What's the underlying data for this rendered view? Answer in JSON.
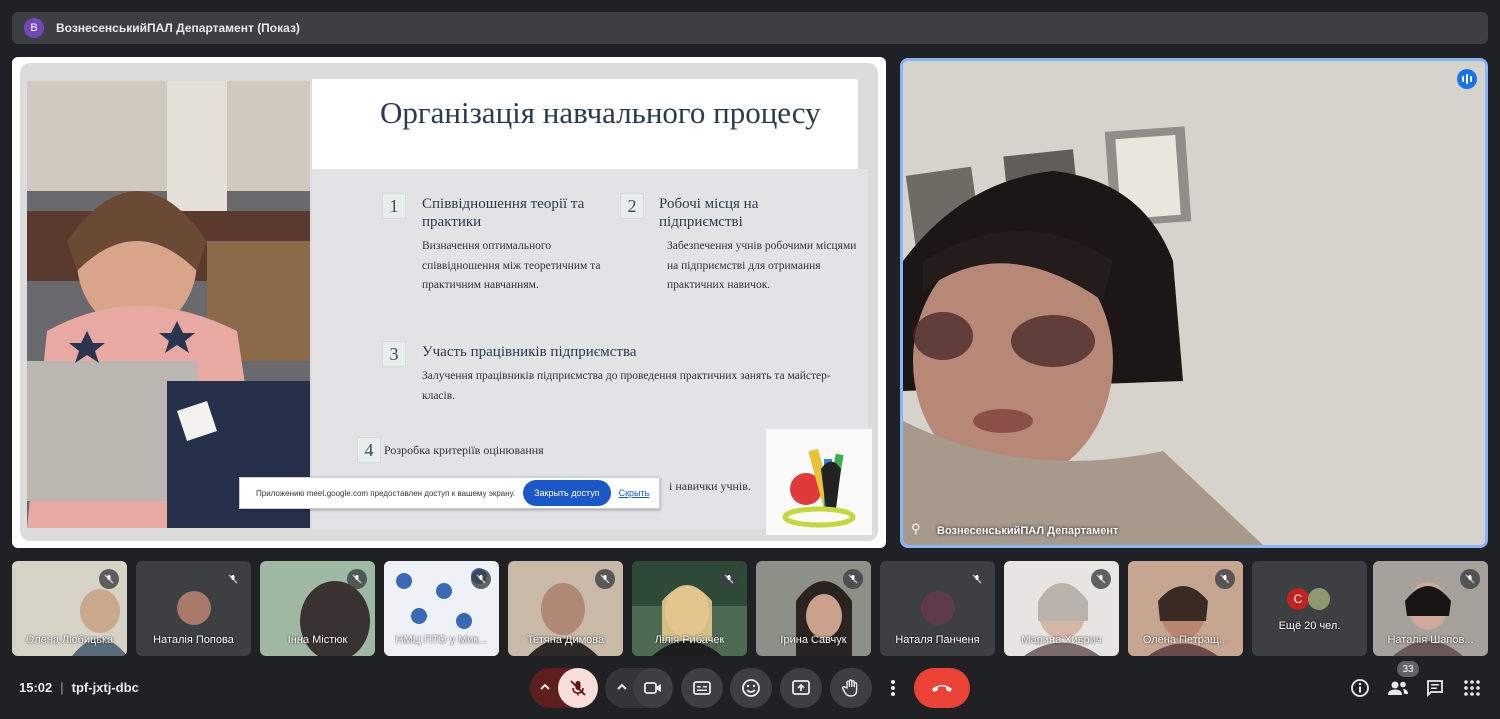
{
  "top_bar": {
    "avatar_letter": "B",
    "title": "ВознесенськийПАЛ Департамент (Показ)"
  },
  "slide": {
    "title": "Організація навчального процесу",
    "items": [
      {
        "num": "1",
        "heading": "Співвідношення теорії та практики",
        "text": "Визначення оптимального співвідношення між теоретичним та практичним навчанням."
      },
      {
        "num": "2",
        "heading": "Робочі місця на підприємстві",
        "text": "Забезпечення учнів робочими місцями на підприємстві для отримання практичних навичок."
      },
      {
        "num": "3",
        "heading": "Участь працівників підприємства",
        "text": "Залучення працівників підприємства до проведення практичних занять та майстер-класів."
      },
      {
        "num": "4",
        "heading": "Розробка критеріїв оцінювання",
        "text": "і навички учнів."
      }
    ],
    "share_banner": {
      "text": "Приложению meet.google.com предоставлен доступ к вашему экрану.",
      "stop_button": "Закрыть доступ",
      "hide_link": "Скрыть"
    }
  },
  "speaker": {
    "name": "ВознесенськийПАЛ Департамент"
  },
  "participants": [
    {
      "name": "Олена Любицька"
    },
    {
      "name": "Наталія Попова"
    },
    {
      "name": "Інна Містюк"
    },
    {
      "name": "НМЦ ПТО у Мик..."
    },
    {
      "name": "Тетяна Димова"
    },
    {
      "name": "Лілія Рибачек"
    },
    {
      "name": "Ірина Савчук"
    },
    {
      "name": "Наталя Панченя"
    },
    {
      "name": "Марина Хиврич"
    },
    {
      "name": "Олена Петращ..."
    },
    {
      "name": "Наталія Шапов..."
    }
  ],
  "more_participants": {
    "avatar_letter": "С",
    "label": "Ещё 20 чел."
  },
  "bottom_bar": {
    "time": "15:02",
    "meeting_code": "tpf-jxtj-dbc",
    "participant_count": "33"
  },
  "colors": {
    "accent": "#8ab4f8",
    "end_call": "#ea4335",
    "mic_off": "#f9dedc"
  }
}
